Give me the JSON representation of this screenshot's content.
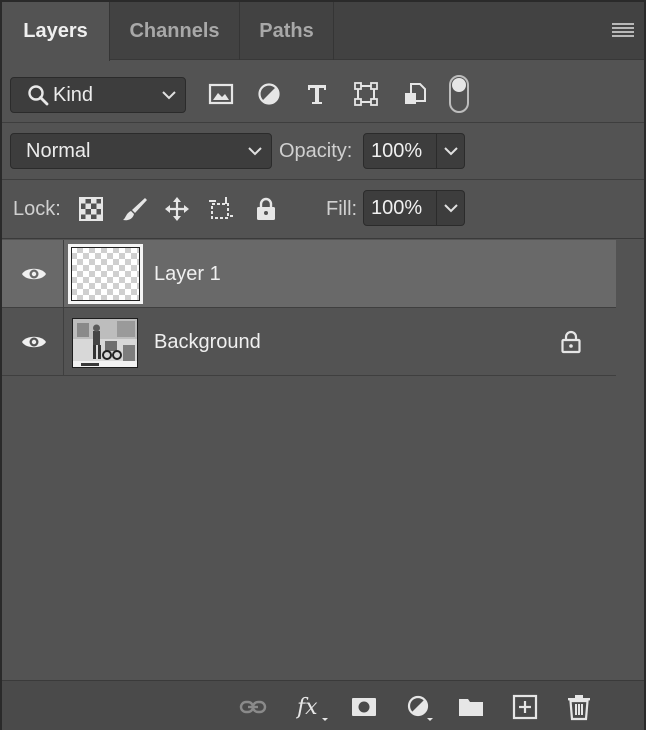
{
  "tabs": [
    {
      "label": "Layers",
      "active": true
    },
    {
      "label": "Channels",
      "active": false
    },
    {
      "label": "Paths",
      "active": false
    }
  ],
  "filter": {
    "kind_label": "Kind",
    "icons": [
      "image-filter-icon",
      "adjustment-filter-icon",
      "type-filter-icon",
      "shape-filter-icon",
      "smart-object-filter-icon"
    ],
    "filter_toggle_on": true
  },
  "blend": {
    "mode": "Normal",
    "opacity_label": "Opacity:",
    "opacity_value": "100%"
  },
  "lock": {
    "label": "Lock:",
    "icons": [
      "lock-transparent-pixels-icon",
      "lock-image-pixels-icon",
      "lock-position-icon",
      "lock-artboard-icon",
      "lock-all-icon"
    ],
    "fill_label": "Fill:",
    "fill_value": "100%"
  },
  "layers": [
    {
      "name": "Layer 1",
      "visible": true,
      "selected": true,
      "locked": false,
      "thumbnail": "transparent"
    },
    {
      "name": "Background",
      "visible": true,
      "selected": false,
      "locked": true,
      "thumbnail": "photo"
    }
  ],
  "bottom_toolbar": [
    "link-layers-icon",
    "fx-icon",
    "layer-mask-icon",
    "adjustment-layer-icon",
    "new-group-icon",
    "new-layer-icon",
    "delete-layer-icon"
  ],
  "colors": {
    "panel_bg": "#535353",
    "tabbar_bg": "#424242",
    "selected_layer_bg": "#696969",
    "field_bg": "#3d3d3d"
  }
}
